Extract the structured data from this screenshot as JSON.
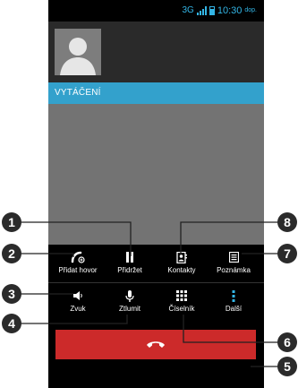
{
  "status": {
    "network": "3G",
    "time": "10:30",
    "ampm": "dop."
  },
  "call": {
    "state": "VYTÁČENÍ"
  },
  "controls": {
    "add_call": "Přidat hovor",
    "hold": "Přidržet",
    "contacts": "Kontakty",
    "note": "Poznámka",
    "speaker": "Zvuk",
    "mute": "Ztlumit",
    "dialpad": "Číselník",
    "more": "Další"
  },
  "callouts": [
    "1",
    "2",
    "3",
    "4",
    "5",
    "6",
    "7",
    "8"
  ],
  "colors": {
    "accent": "#33b5e5",
    "calling_bar": "#33a1cc",
    "end_call": "#cc2a2a",
    "background": "#737373"
  }
}
